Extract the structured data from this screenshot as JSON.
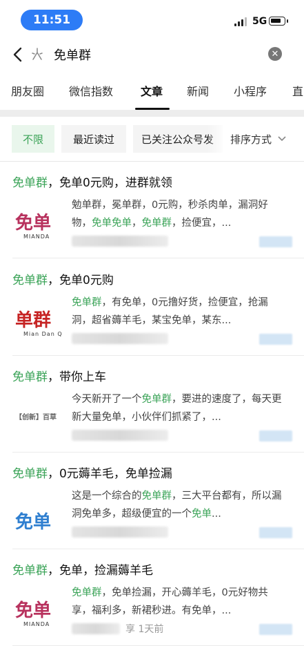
{
  "status_bar": {
    "time": "11:51",
    "network": "5G"
  },
  "search": {
    "query": "免单群"
  },
  "tabs": [
    {
      "label": "朋友圈"
    },
    {
      "label": "微信指数"
    },
    {
      "label": "文章"
    },
    {
      "label": "新闻"
    },
    {
      "label": "小程序"
    },
    {
      "label": "直"
    }
  ],
  "filters": {
    "chips": [
      {
        "label": "不限"
      },
      {
        "label": "最近读过"
      },
      {
        "label": "已关注公众号发"
      }
    ],
    "sort_label": "排序方式"
  },
  "results": [
    {
      "title_hl": "免单群",
      "title_rest": "，免单0元购，进群就领",
      "snippet": [
        {
          "t": "勉单群，冕单群，0元购，秒杀肉单，漏洞好物，",
          "hl": false
        },
        {
          "t": "免单免单",
          "hl": true
        },
        {
          "t": "，",
          "hl": false
        },
        {
          "t": "免单群",
          "hl": true
        },
        {
          "t": "，捡便宜，...",
          "hl": false
        }
      ],
      "meta_text": "",
      "thumb": {
        "text": "免单",
        "sub": "MIANDA",
        "color": "#b8325e"
      }
    },
    {
      "title_hl": "免单群",
      "title_rest": "，免单0元购",
      "snippet": [
        {
          "t": "免单群",
          "hl": true
        },
        {
          "t": "，有免单，0元撸好货，捡便宜，抢漏洞，超省薅羊毛，某宝免单，某东...",
          "hl": false
        }
      ],
      "meta_text": "",
      "thumb": {
        "text": "单群",
        "sub": "Mian Dan Qun",
        "color": "#c62424"
      }
    },
    {
      "title_hl": "免单群",
      "title_rest": "，带你上车",
      "snippet": [
        {
          "t": "今天新开了一个",
          "hl": false
        },
        {
          "t": "免单群",
          "hl": true
        },
        {
          "t": "，要进的速度了，每天更新大量免单，小伙伴们抓紧了，...",
          "hl": false
        }
      ],
      "meta_text": "",
      "thumb": {
        "text": "【创新】百草",
        "sub": "",
        "color": "#666666"
      }
    },
    {
      "title_hl": "免单群",
      "title_rest": "，0元薅羊毛，免单捡漏",
      "snippet": [
        {
          "t": "这是一个综合的",
          "hl": false
        },
        {
          "t": "免单群",
          "hl": true
        },
        {
          "t": "，三大平台都有，所以漏洞免单多，超级便宜的一个",
          "hl": false
        },
        {
          "t": "免单",
          "hl": true
        },
        {
          "t": "...",
          "hl": false
        }
      ],
      "meta_text": "",
      "thumb": {
        "text": "免单",
        "sub": "",
        "color": "#2f7fd0"
      }
    },
    {
      "title_hl": "免单群",
      "title_rest": "，免单，捡漏薅羊毛",
      "snippet": [
        {
          "t": "免单群",
          "hl": true
        },
        {
          "t": "，免单捡漏，开心薅羊毛，0元好物共享，福利多，新裙秒进。有免单，...",
          "hl": false
        }
      ],
      "meta_text": "享  1天前",
      "thumb": {
        "text": "免单",
        "sub": "MIANDA",
        "color": "#b8325e"
      }
    }
  ],
  "colors": {
    "accent_green": "#3aa357",
    "time_pill": "#2d7cf6"
  },
  "icons": [
    "back-arrow-icon",
    "sparkle-icon",
    "clear-icon",
    "chevron-down-icon",
    "signal-icon",
    "battery-icon"
  ]
}
